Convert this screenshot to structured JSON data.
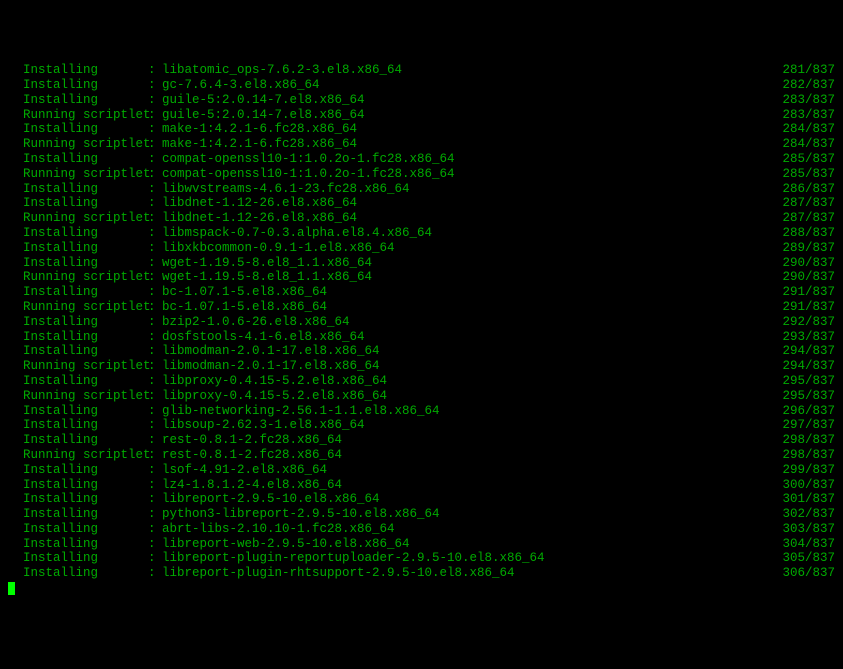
{
  "total": 837,
  "lines": [
    {
      "action": "Installing",
      "pkg": "libatomic_ops-7.6.2-3.el8.x86_64",
      "count": 281
    },
    {
      "action": "Installing",
      "pkg": "gc-7.6.4-3.el8.x86_64",
      "count": 282
    },
    {
      "action": "Installing",
      "pkg": "guile-5:2.0.14-7.el8.x86_64",
      "count": 283
    },
    {
      "action": "Running scriptlet",
      "pkg": "guile-5:2.0.14-7.el8.x86_64",
      "count": 283
    },
    {
      "action": "Installing",
      "pkg": "make-1:4.2.1-6.fc28.x86_64",
      "count": 284
    },
    {
      "action": "Running scriptlet",
      "pkg": "make-1:4.2.1-6.fc28.x86_64",
      "count": 284
    },
    {
      "action": "Installing",
      "pkg": "compat-openssl10-1:1.0.2o-1.fc28.x86_64",
      "count": 285
    },
    {
      "action": "Running scriptlet",
      "pkg": "compat-openssl10-1:1.0.2o-1.fc28.x86_64",
      "count": 285
    },
    {
      "action": "Installing",
      "pkg": "libwvstreams-4.6.1-23.fc28.x86_64",
      "count": 286
    },
    {
      "action": "Installing",
      "pkg": "libdnet-1.12-26.el8.x86_64",
      "count": 287
    },
    {
      "action": "Running scriptlet",
      "pkg": "libdnet-1.12-26.el8.x86_64",
      "count": 287
    },
    {
      "action": "Installing",
      "pkg": "libmspack-0.7-0.3.alpha.el8.4.x86_64",
      "count": 288
    },
    {
      "action": "Installing",
      "pkg": "libxkbcommon-0.9.1-1.el8.x86_64",
      "count": 289
    },
    {
      "action": "Installing",
      "pkg": "wget-1.19.5-8.el8_1.1.x86_64",
      "count": 290
    },
    {
      "action": "Running scriptlet",
      "pkg": "wget-1.19.5-8.el8_1.1.x86_64",
      "count": 290
    },
    {
      "action": "Installing",
      "pkg": "bc-1.07.1-5.el8.x86_64",
      "count": 291
    },
    {
      "action": "Running scriptlet",
      "pkg": "bc-1.07.1-5.el8.x86_64",
      "count": 291
    },
    {
      "action": "Installing",
      "pkg": "bzip2-1.0.6-26.el8.x86_64",
      "count": 292
    },
    {
      "action": "Installing",
      "pkg": "dosfstools-4.1-6.el8.x86_64",
      "count": 293
    },
    {
      "action": "Installing",
      "pkg": "libmodman-2.0.1-17.el8.x86_64",
      "count": 294
    },
    {
      "action": "Running scriptlet",
      "pkg": "libmodman-2.0.1-17.el8.x86_64",
      "count": 294
    },
    {
      "action": "Installing",
      "pkg": "libproxy-0.4.15-5.2.el8.x86_64",
      "count": 295
    },
    {
      "action": "Running scriptlet",
      "pkg": "libproxy-0.4.15-5.2.el8.x86_64",
      "count": 295
    },
    {
      "action": "Installing",
      "pkg": "glib-networking-2.56.1-1.1.el8.x86_64",
      "count": 296
    },
    {
      "action": "Installing",
      "pkg": "libsoup-2.62.3-1.el8.x86_64",
      "count": 297
    },
    {
      "action": "Installing",
      "pkg": "rest-0.8.1-2.fc28.x86_64",
      "count": 298
    },
    {
      "action": "Running scriptlet",
      "pkg": "rest-0.8.1-2.fc28.x86_64",
      "count": 298
    },
    {
      "action": "Installing",
      "pkg": "lsof-4.91-2.el8.x86_64",
      "count": 299
    },
    {
      "action": "Installing",
      "pkg": "lz4-1.8.1.2-4.el8.x86_64",
      "count": 300
    },
    {
      "action": "Installing",
      "pkg": "libreport-2.9.5-10.el8.x86_64",
      "count": 301
    },
    {
      "action": "Installing",
      "pkg": "python3-libreport-2.9.5-10.el8.x86_64",
      "count": 302
    },
    {
      "action": "Installing",
      "pkg": "abrt-libs-2.10.10-1.fc28.x86_64",
      "count": 303
    },
    {
      "action": "Installing",
      "pkg": "libreport-web-2.9.5-10.el8.x86_64",
      "count": 304
    },
    {
      "action": "Installing",
      "pkg": "libreport-plugin-reportuploader-2.9.5-10.el8.x86_64",
      "count": 305
    },
    {
      "action": "Installing",
      "pkg": "libreport-plugin-rhtsupport-2.9.5-10.el8.x86_64",
      "count": 306
    }
  ]
}
